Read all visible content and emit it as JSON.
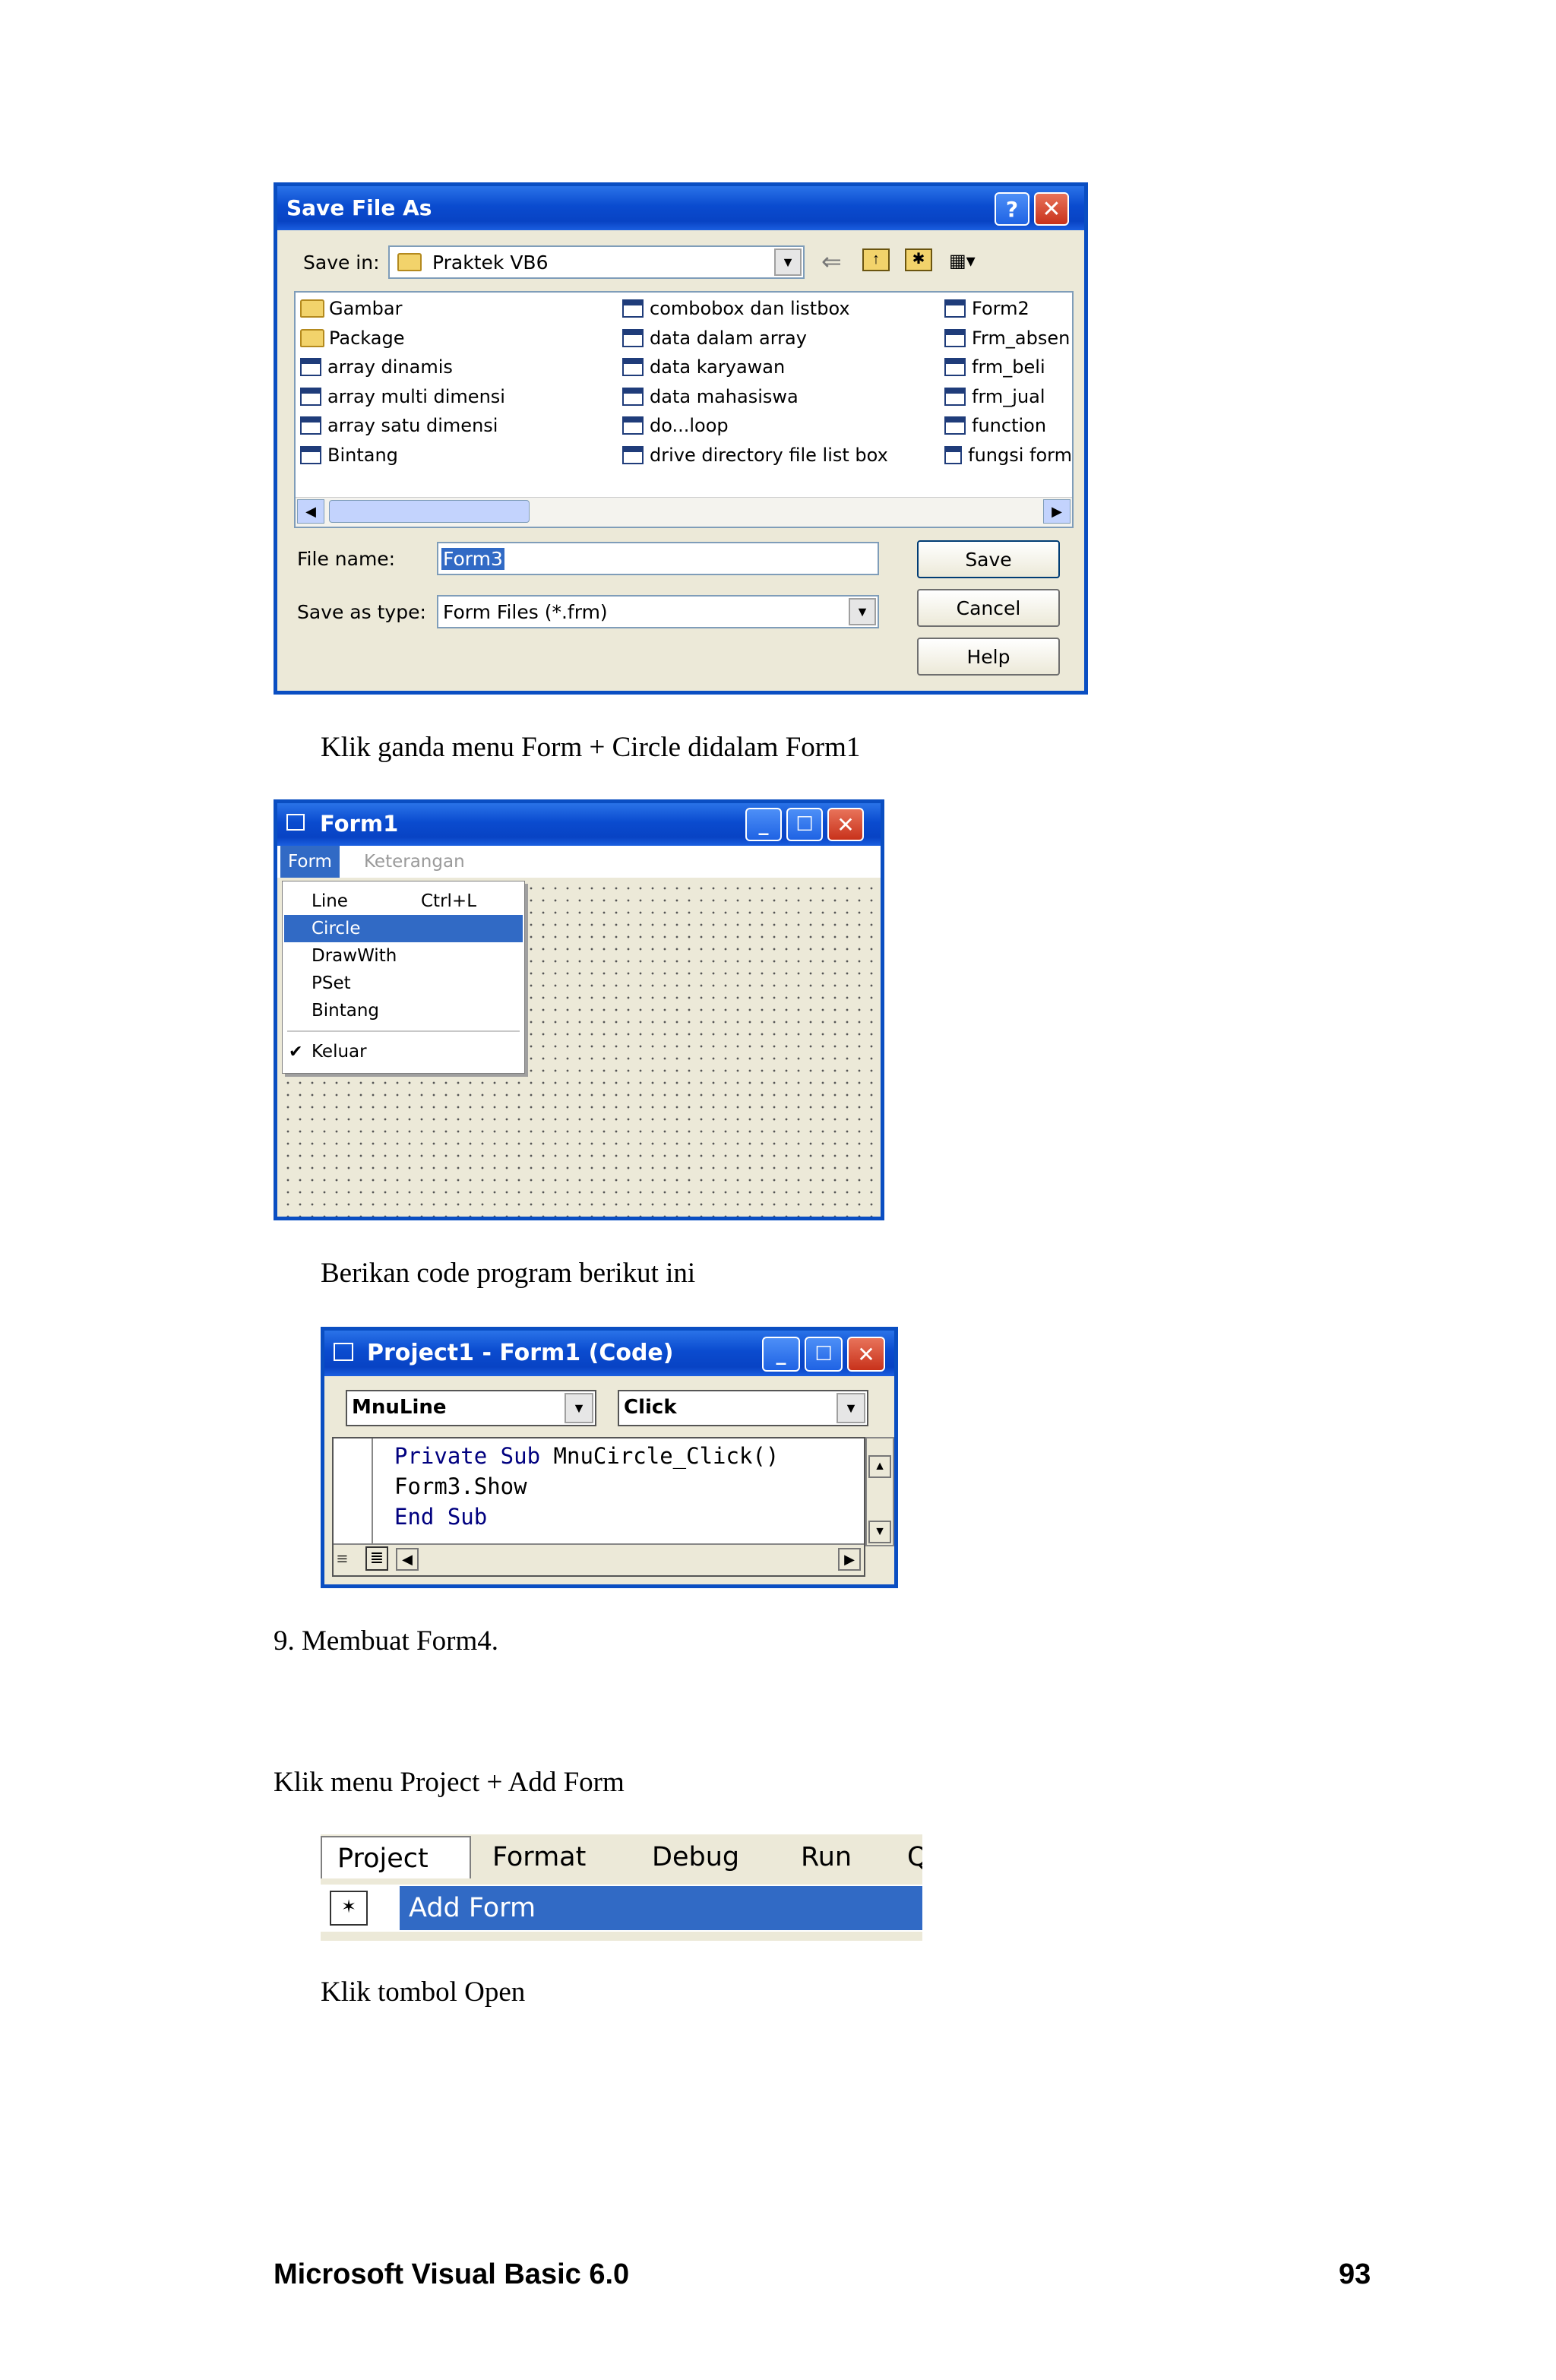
{
  "save_dialog": {
    "title": "Save File As",
    "save_in_label": "Save in:",
    "save_in_value": "Praktek VB6",
    "files_col1": [
      "Gambar",
      "Package",
      "array dinamis",
      "array multi dimensi",
      "array satu dimensi",
      "Bintang"
    ],
    "files_col2": [
      "combobox dan listbox",
      "data dalam array",
      "data karyawan",
      "data mahasiswa",
      "do...loop",
      "drive directory file list box"
    ],
    "files_col3": [
      "Form2",
      "Frm_absen",
      "frm_beli",
      "frm_jual",
      "function",
      "fungsi form"
    ],
    "file_name_label": "File name:",
    "file_name_value": "Form3",
    "save_type_label": "Save as type:",
    "save_type_value": "Form Files (*.frm)",
    "save_button": "Save",
    "cancel_button": "Cancel",
    "help_button": "Help"
  },
  "instruction_1": "Klik ganda menu Form + Circle didalam Form1",
  "form1": {
    "title": "Form1",
    "menu_bar": [
      "Form",
      "Keterangan"
    ],
    "menu_items": [
      {
        "label": "Line",
        "shortcut": "Ctrl+L"
      },
      {
        "label": "Circle",
        "shortcut": ""
      },
      {
        "label": "DrawWith",
        "shortcut": ""
      },
      {
        "label": "PSet",
        "shortcut": ""
      },
      {
        "label": "Bintang",
        "shortcut": ""
      },
      {
        "label": "Keluar",
        "shortcut": ""
      }
    ]
  },
  "instruction_2": "Berikan code program berikut ini",
  "code_window": {
    "title": "Project1 - Form1 (Code)",
    "object_combo": "MnuLine",
    "proc_combo": "Click",
    "code": {
      "line1_kw": "Private Sub",
      "line1_rest": " MnuCircle_Click()",
      "line2": "Form3.Show",
      "line3_kw": "End Sub"
    }
  },
  "step_9": "9. Membuat Form4.",
  "instruction_3": "Klik menu Project + Add Form",
  "project_menu": {
    "menu_bar": [
      "Project",
      "Format",
      "Debug",
      "Run",
      "Q"
    ],
    "item": "Add Form"
  },
  "instruction_4": "Klik tombol Open",
  "footer": {
    "left": "Microsoft Visual Basic 6.0",
    "right": "93"
  }
}
